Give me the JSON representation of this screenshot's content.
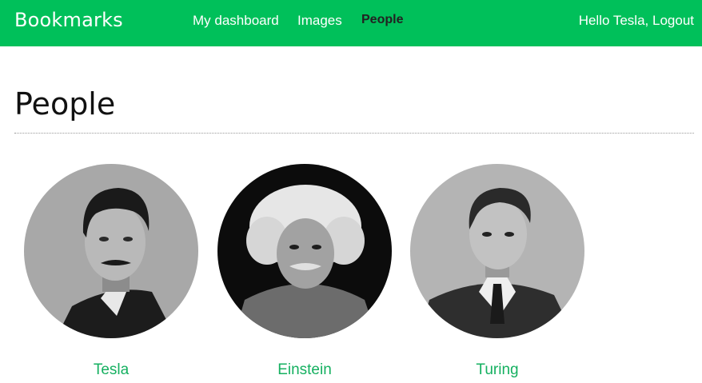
{
  "header": {
    "logo": "Bookmarks",
    "nav": [
      {
        "label": "My dashboard"
      },
      {
        "label": "Images"
      },
      {
        "label": "People"
      }
    ],
    "greeting": "Hello Tesla,",
    "logout_label": "Logout",
    "brand_color": "#00c05a"
  },
  "main": {
    "title": "People",
    "people": [
      {
        "name": "Tesla",
        "photo_icon": "tesla-portrait"
      },
      {
        "name": "Einstein",
        "photo_icon": "einstein-portrait"
      },
      {
        "name": "Turing",
        "photo_icon": "turing-portrait"
      }
    ],
    "link_color": "#15b060"
  }
}
